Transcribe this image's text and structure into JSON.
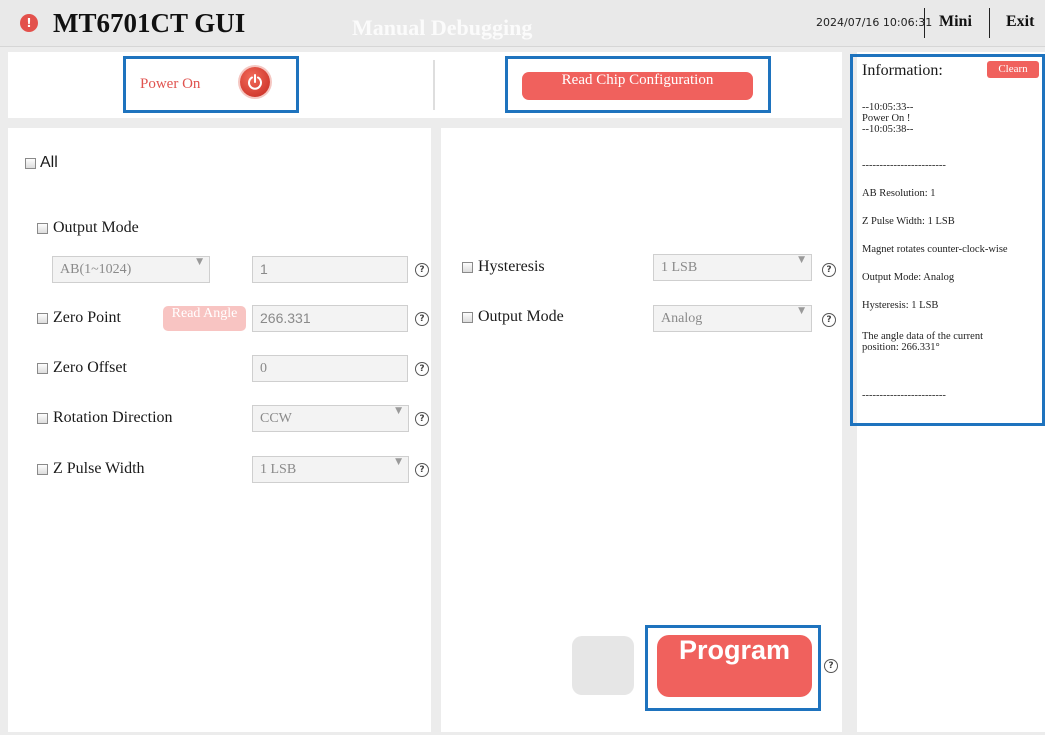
{
  "header": {
    "app_title": "MT6701CT GUI",
    "mode_title": "Manual Debugging",
    "clock": "2024/07/16 10:06:31",
    "mini_label": "Mini",
    "exit_label": "Exit",
    "warn_glyph": "!"
  },
  "toolbar": {
    "power_label": "Power On",
    "read_config_label": "Read Chip Configuration"
  },
  "left_panel": {
    "all_label": "All",
    "output_mode": {
      "label": "Output Mode",
      "select_value": "AB(1~1024)",
      "input_value": "1"
    },
    "zero_point": {
      "label": "Zero Point",
      "button_label": "Read Angle",
      "value": "266.331"
    },
    "zero_offset": {
      "label": "Zero Offset",
      "value": "0"
    },
    "rotation_direction": {
      "label": "Rotation Direction",
      "value": "CCW"
    },
    "z_pulse_width": {
      "label": "Z Pulse Width",
      "value": "1 LSB"
    }
  },
  "right_panel": {
    "hysteresis": {
      "label": "Hysteresis",
      "value": "1 LSB"
    },
    "output_mode": {
      "label": "Output Mode",
      "value": "Analog"
    },
    "program_label": "Program"
  },
  "info_panel": {
    "title": "Information:",
    "clear_label": "Clearn",
    "log": [
      "--10:05:33--",
      "Power On !",
      "--10:05:38--",
      "------------------------",
      "AB Resolution: 1",
      "Z Pulse Width: 1 LSB",
      "Magnet rotates counter-clock-wise",
      "Output Mode: Analog",
      "Hysteresis: 1 LSB",
      "The angle data of the current",
      "position: 266.331°",
      "------------------------"
    ]
  },
  "icons": {
    "help": "?",
    "dropdown": "▼"
  },
  "colors": {
    "accent_red": "#f0615d",
    "highlight_blue": "#1e73be"
  }
}
